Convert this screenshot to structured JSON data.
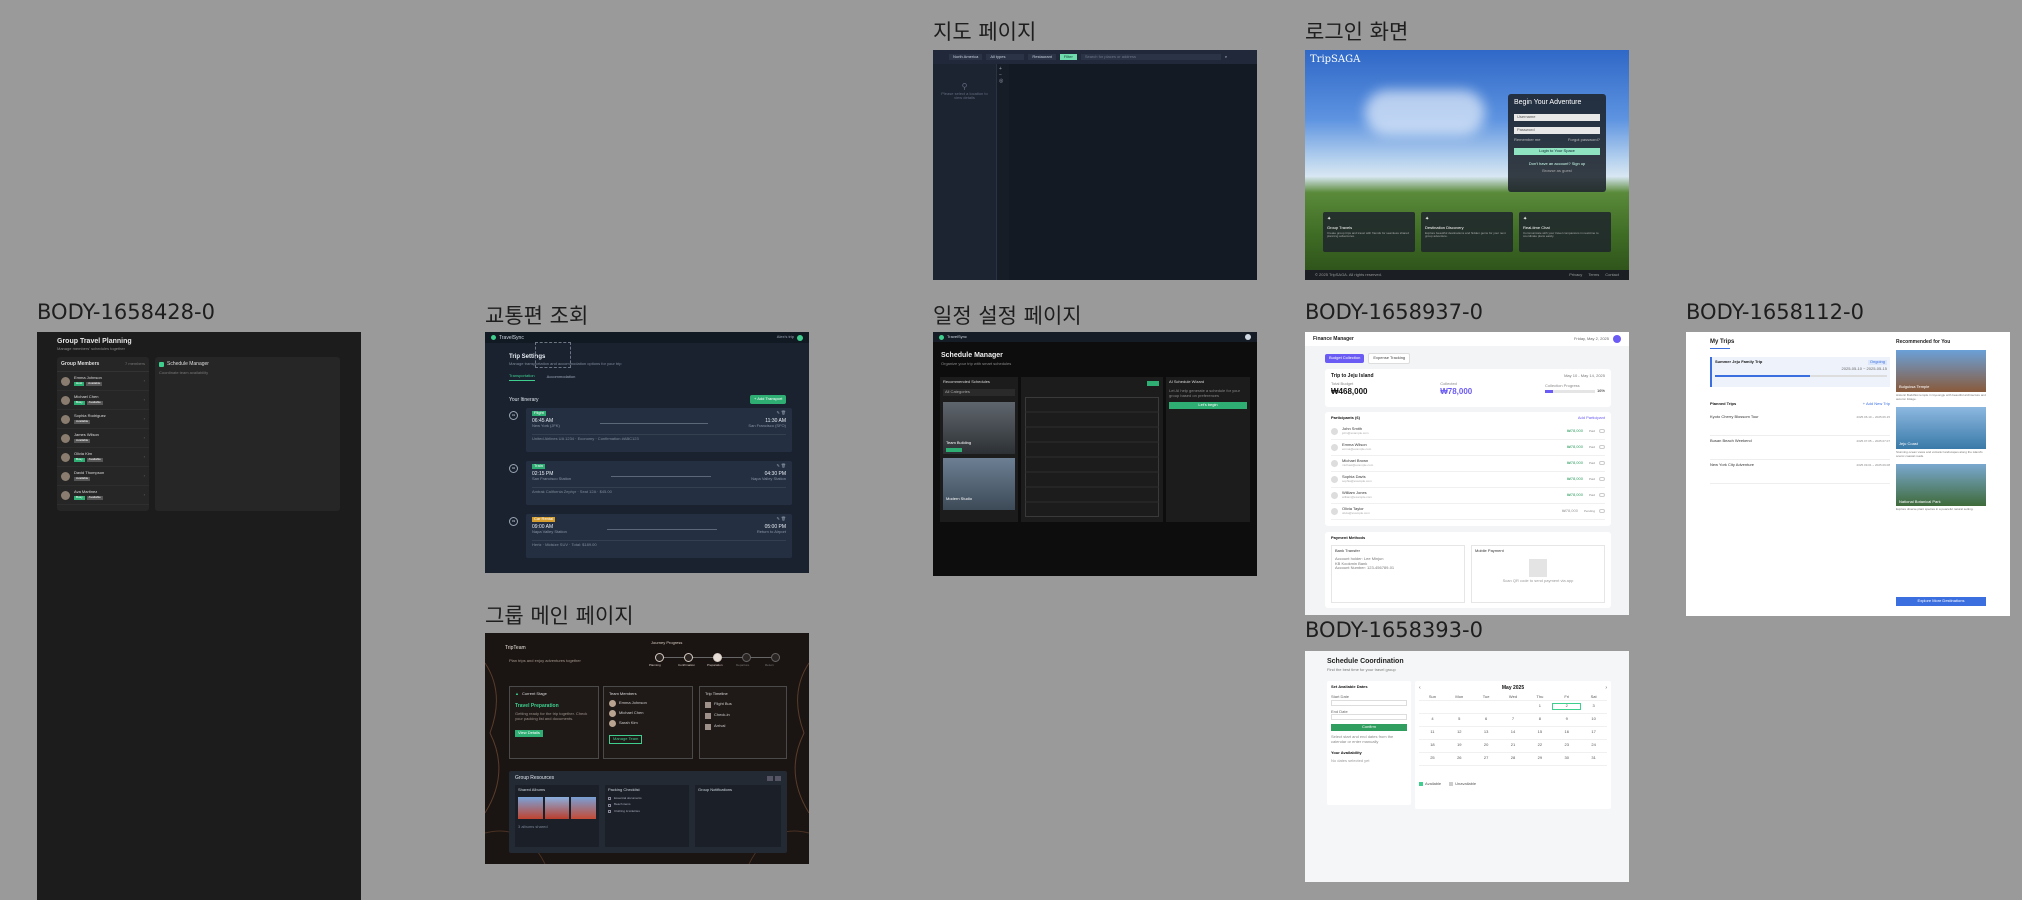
{
  "frames": {
    "group_planning": {
      "label": "BODY-1658428-0",
      "title": "Group Travel Planning",
      "subtitle": "Manage members' schedules together",
      "members_header": "Group Members",
      "members_count": "7 members",
      "members": [
        {
          "name": "Emma Johnson",
          "tags": [
            "Host",
            "Available"
          ]
        },
        {
          "name": "Michael Chen",
          "tags": [
            "Busy",
            "Available"
          ]
        },
        {
          "name": "Sophia Rodriguez",
          "tags": [
            "Available"
          ]
        },
        {
          "name": "James Wilson",
          "tags": [
            "Available"
          ]
        },
        {
          "name": "Olivia Kim",
          "tags": [
            "Busy",
            "Available"
          ]
        },
        {
          "name": "David Thompson",
          "tags": [
            "Available"
          ]
        },
        {
          "name": "Ava Martinez",
          "tags": [
            "Busy",
            "Available"
          ]
        }
      ],
      "schedule_title": "Schedule Manager",
      "schedule_subtitle": "Coordinate team availability"
    },
    "transport": {
      "label": "교통편 조회",
      "brand": "TravelSync",
      "user": "Alex's trip",
      "title": "Trip Settings",
      "subtitle": "Manage transportation and accommodation options for your trip",
      "tabs": [
        "Transportation",
        "Accommodation"
      ],
      "itinerary_title": "Your Itinerary",
      "add_button": "+ Add Transport",
      "items": [
        {
          "day": "01",
          "type": "Flight",
          "dep_time": "06:45 AM",
          "dep_place": "New York (JFK)",
          "arr_time": "11:30 AM",
          "arr_place": "San Francisco (SFO)",
          "note": "United Airlines UA 1234 · Economy · Confirmation #ABC123"
        },
        {
          "day": "02",
          "type": "Train",
          "dep_time": "02:15 PM",
          "dep_place": "San Francisco Station",
          "arr_time": "04:30 PM",
          "arr_place": "Napa Valley Station",
          "note": "Amtrak California Zephyr · Seat 12A · $45.00"
        },
        {
          "day": "03",
          "type": "Car Rental",
          "dep_time": "09:00 AM",
          "dep_place": "Napa Valley Station",
          "arr_time": "05:00 PM",
          "arr_place": "Return to Airport",
          "note": "Hertz · Midsize SUV · Total: $189.00"
        }
      ]
    },
    "group_main": {
      "label": "그룹 메인 페이지",
      "title": "TripTeam",
      "subtitle": "Plan trips and enjoy adventures together",
      "progress_title": "Journey Progress",
      "steps": [
        "Planning",
        "Confirmation",
        "Preparation",
        "Departure",
        "Return"
      ],
      "stage_title": "Current Stage",
      "stage_name": "Travel Preparation",
      "stage_desc": "Getting ready for the trip together. Check your packing list and documents.",
      "stage_button": "View Details",
      "team_title": "Team Members",
      "team": [
        "Emma Johnson",
        "Michael Chen",
        "Sarah Kim"
      ],
      "team_button": "Manage Team",
      "timeline_title": "Trip Timeline",
      "timeline": [
        "Flight Bus",
        "Check-in",
        "Arrival"
      ],
      "resources_title": "Group Resources",
      "albums_title": "Shared Albums",
      "albums_meta": "3 albums shared",
      "packing_title": "Packing Checklist",
      "packing": [
        "Essential documents",
        "Beach items",
        "Clothing & toiletries"
      ],
      "notes_title": "Group Notifications"
    },
    "map": {
      "label": "지도 페이지",
      "controls": [
        "North America",
        "All types",
        "Restaurant"
      ],
      "filter_label": "Filter",
      "search_placeholder": "Search for places or address",
      "empty_text": "Please select a location to view details"
    },
    "schedule": {
      "label": "일정 설정 페이지",
      "brand": "TravelSync",
      "title": "Schedule Manager",
      "subtitle": "Organize your trip with smart schedules",
      "rec_title": "Recommended Schedules",
      "rec_filter": "All Categories",
      "rec_items": [
        "Team Building",
        "Modern Studio"
      ],
      "wizard_title": "AI Schedule Wizard",
      "wizard_text": "Let AI help generate a schedule for your group based on preferences",
      "wizard_button": "Let's begin"
    },
    "login": {
      "label": "로그인 화면",
      "logo": "TripSAGA",
      "heading": "Begin Your Adventure",
      "username_placeholder": "Username",
      "password_placeholder": "Password",
      "remember": "Remember me",
      "forgot": "Forgot password?",
      "login_button": "Login to Your Space",
      "signup": "Don't have an account? Sign up",
      "browse": "Browse as guest",
      "features": [
        {
          "title": "Group Travels",
          "desc": "Create group trips and travel with friends for seamless shared planning adventures."
        },
        {
          "title": "Destination Discovery",
          "desc": "Explore beautiful destinations and hidden gems for your next group adventure."
        },
        {
          "title": "Real-time Chat",
          "desc": "Communicate with your travel companions in real-time to coordinate plans easily."
        }
      ],
      "copyright": "© 2025 TripSAGA. All rights reserved.",
      "footer_links": [
        "Privacy",
        "Terms",
        "Contact"
      ]
    },
    "finance": {
      "label": "BODY-1658937-0",
      "title": "Finance Manager",
      "date": "Friday, May 2, 2025",
      "tabs": [
        "Budget Collection",
        "Expense Tracking"
      ],
      "trip_name": "Trip to Jeju Island",
      "trip_dates": "May 10 - May 14, 2025",
      "total_label": "Total Budget",
      "total_value": "₩468,000",
      "collected_label": "Collected",
      "collected_value": "₩78,000",
      "progress_label": "Collection Progress",
      "progress_value": "16%",
      "progress_fraction": 0.16,
      "participants_title": "Participants (6)",
      "add_participant": "Add Participant",
      "participants": [
        {
          "name": "John Smith",
          "email": "john@example.com",
          "amount": "₩78,000",
          "status": "Paid"
        },
        {
          "name": "Emma Wilson",
          "email": "emma@example.com",
          "amount": "₩78,000",
          "status": "Paid"
        },
        {
          "name": "Michael Brown",
          "email": "michael@example.com",
          "amount": "₩78,000",
          "status": "Paid"
        },
        {
          "name": "Sophia Davis",
          "email": "sophia@example.com",
          "amount": "₩78,000",
          "status": "Paid"
        },
        {
          "name": "William Jones",
          "email": "william@example.com",
          "amount": "₩78,000",
          "status": "Paid"
        },
        {
          "name": "Olivia Taylor",
          "email": "olivia@example.com",
          "amount": "₩78,000",
          "status": "Pending"
        }
      ],
      "payment_title": "Payment Methods",
      "bank_title": "Bank Transfer",
      "bank_lines": [
        "Account holder: Lee Minjun",
        "KB Kookmin Bank",
        "Account Number: 123-456789-01"
      ],
      "mobile_title": "Mobile Payment",
      "mobile_caption": "Scan QR code to send payment via app"
    },
    "coordination": {
      "label": "BODY-1658393-0",
      "title": "Schedule Coordination",
      "subtitle": "Find the best time for your travel group",
      "form_title": "Set Available Dates",
      "start_label": "Start Date",
      "end_label": "End Date",
      "confirm_button": "Confirm",
      "form_hint": "Select start and end dates from the calendar or enter manually",
      "availability_title": "Your Availability",
      "availability_empty": "No dates selected yet",
      "month": "May 2025",
      "weekdays": [
        "Sun",
        "Mon",
        "Tue",
        "Wed",
        "Thu",
        "Fri",
        "Sat"
      ],
      "legend": [
        "Available",
        "Unavailable"
      ]
    },
    "my_trips": {
      "label": "BODY-1658112-0",
      "title": "My Trips",
      "featured_trip": "Summer Jeju Family Trip",
      "featured_badge": "Ongoing",
      "featured_dates": "2025-05-10 ~ 2025-05-15",
      "planned_title": "Planned Trips",
      "add_trip": "+ Add New Trip",
      "planned": [
        {
          "name": "Kyoto Cherry Blossom Tour",
          "date": "2025.06.10 ~ 2025.06.15"
        },
        {
          "name": "Busan Beach Weekend",
          "date": "2025.07.05 ~ 2025.07.07"
        },
        {
          "name": "New York City Adventure",
          "date": "2025.09.01 ~ 2025.09.08"
        }
      ],
      "rec_title": "Recommended for You",
      "recommendations": [
        {
          "name": "Bulguksa Temple",
          "desc": "Historic Buddhist temple in Gyeongju with beautiful architecture and autumn foliage."
        },
        {
          "name": "Jeju Coast",
          "desc": "Stunning ocean views and volcanic landscapes along the island's scenic coastal roads."
        },
        {
          "name": "National Botanical Park",
          "desc": "Explore diverse plant species in a peaceful natural setting."
        }
      ],
      "explore_button": "Explore More Destinations"
    }
  }
}
